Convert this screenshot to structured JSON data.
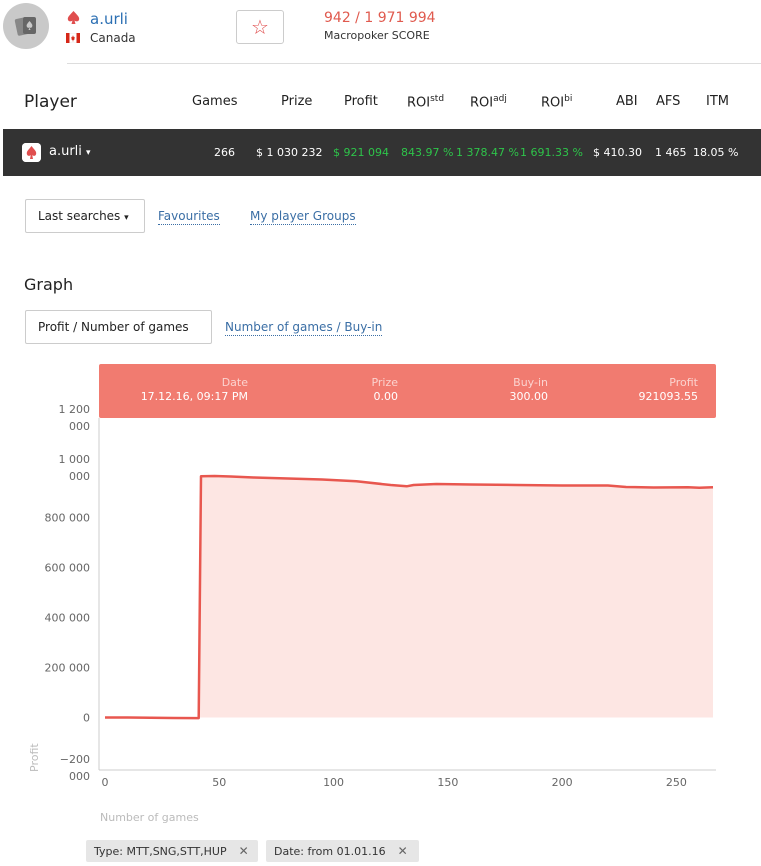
{
  "header": {
    "player_name": "a.urli",
    "country": "Canada",
    "score": "942 / 1 971 994",
    "score_label": "Macropoker SCORE",
    "favourite_glyph": "☆"
  },
  "table": {
    "title": "Player",
    "columns": {
      "games": "Games",
      "prize": "Prize",
      "profit": "Profit",
      "roi_std": "ROI",
      "roi_std_sup": "std",
      "roi_adj": "ROI",
      "roi_adj_sup": "adj",
      "roi_bi": "ROI",
      "roi_bi_sup": "bi",
      "abi": "ABI",
      "afs": "AFS",
      "itm": "ITM"
    },
    "row": {
      "name": "a.urli",
      "caret": "▾",
      "games": "266",
      "prize": "$ 1 030 232",
      "profit": "$ 921 094",
      "roi_std": "843.97 %",
      "roi_adj": "1 378.47 %",
      "roi_bi": "1 691.33 %",
      "abi": "$ 410.30",
      "afs": "1 465",
      "itm": "18.05 %"
    }
  },
  "nav": {
    "last_searches": "Last searches",
    "caret": "▾",
    "favourites": "Favourites",
    "groups": "My player Groups"
  },
  "graph": {
    "title": "Graph",
    "tab_active": "Profit / Number of games",
    "tab_other": "Number of games / Buy-in"
  },
  "tooltip": {
    "date_label": "Date",
    "date_value": "17.12.16, 09:17 PM",
    "prize_label": "Prize",
    "prize_value": "0.00",
    "buyin_label": "Buy-in",
    "buyin_value": "300.00",
    "profit_label": "Profit",
    "profit_value": "921093.55"
  },
  "chips": {
    "type": "Type: MTT,SNG,STT,HUP",
    "date": "Date: from 01.01.16",
    "close": "✕"
  },
  "colors": {
    "accent": "#e8574f",
    "tooltip_bg": "#f17b70",
    "bar_bg": "#333333",
    "green": "#2ec44a",
    "link": "#3a6ea5"
  },
  "chart_data": {
    "type": "area",
    "xlabel": "Number of games",
    "ylabel": "Profit",
    "xlim": [
      0,
      266
    ],
    "ylim": [
      -200000,
      1200000
    ],
    "x_ticks": [
      0,
      50,
      100,
      150,
      200,
      250
    ],
    "x_tick_labels": [
      "0",
      "50",
      "100",
      "150",
      "200",
      "250"
    ],
    "y_ticks": [
      -200000,
      0,
      200000,
      400000,
      600000,
      800000,
      1000000,
      1200000
    ],
    "y_tick_labels": [
      "−200\n000",
      "0",
      "200 000",
      "400 000",
      "600 000",
      "800 000",
      "1 000\n000",
      "1 200\n000"
    ],
    "series": [
      {
        "x": [
          0,
          10,
          20,
          30,
          40,
          41,
          42,
          48,
          55,
          65,
          80,
          95,
          110,
          125,
          132,
          135,
          145,
          160,
          180,
          200,
          220,
          228,
          240,
          255,
          260,
          266
        ],
        "y": [
          0,
          0,
          -1000,
          -2000,
          -2500,
          -2500,
          965000,
          966000,
          964000,
          960000,
          956000,
          952000,
          945000,
          930000,
          925000,
          930000,
          934000,
          932000,
          930000,
          928000,
          928000,
          922000,
          920000,
          921000,
          919000,
          921094
        ]
      }
    ]
  }
}
